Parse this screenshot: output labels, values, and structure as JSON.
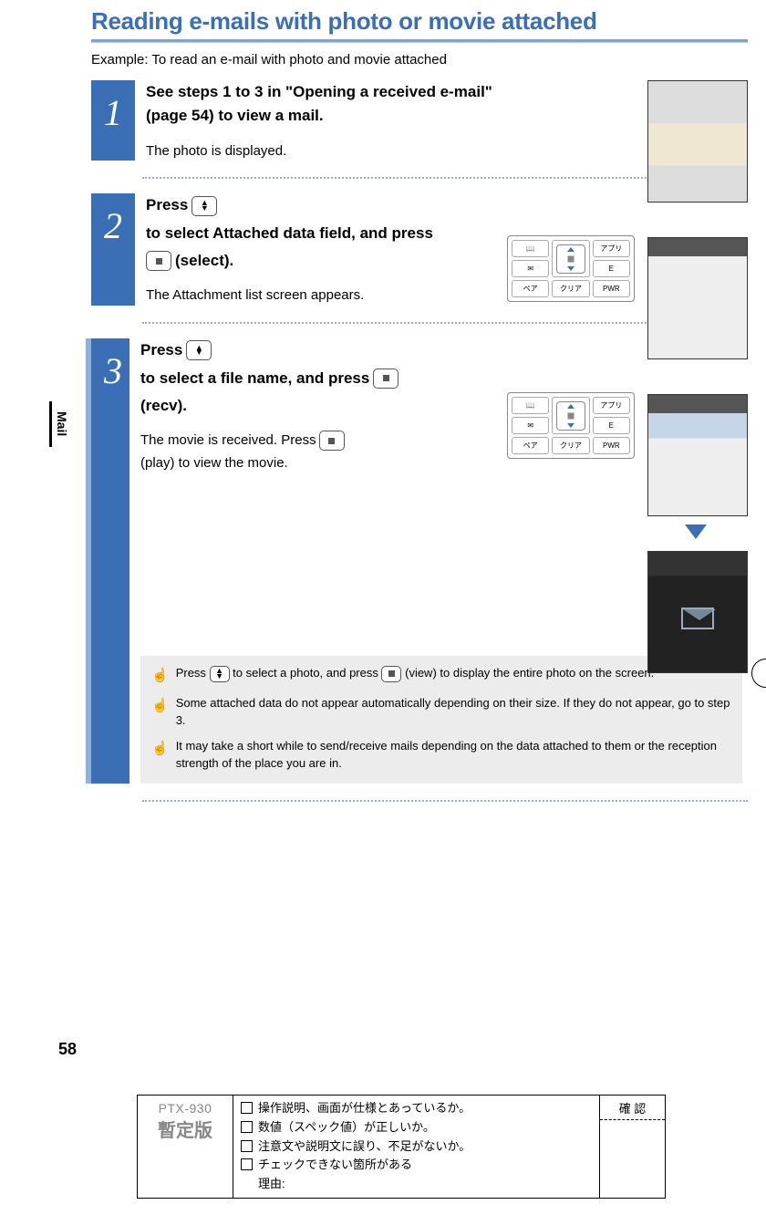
{
  "title": "Reading e-mails with photo or movie attached",
  "example": "Example: To read an e-mail with photo and movie attached",
  "side_tab": "Mail",
  "page_number": "58",
  "steps": [
    {
      "num": "1",
      "head": "See steps 1 to 3 in \"Opening a received e-mail\" (page 54) to view a mail.",
      "desc": "The photo is displayed."
    },
    {
      "num": "2",
      "head_pre": "Press ",
      "head_mid": " to select Attached data field, and press ",
      "head_post": " (select).",
      "desc": "The Attachment list screen appears."
    },
    {
      "num": "3",
      "head_pre": "Press ",
      "head_mid": " to select a file name, and press ",
      "head_post": " (recv).",
      "desc_pre": "The movie is received. Press ",
      "desc_post": " (play) to view the movie."
    }
  ],
  "tips": [
    {
      "pre": "Press ",
      "mid": " to select a photo, and press ",
      "post": " (view) to display the entire photo on the screen."
    },
    {
      "text": "Some attached data do not appear automatically depending on their size. If they do not appear, go to step 3."
    },
    {
      "text": "It may take a short while to send/receive mails depending on the data attached to them or the reception strength of the place you are in."
    }
  ],
  "keypad": {
    "top_left": "📖",
    "top_right": "アプリ",
    "mid_left": "✉",
    "mid_right": "E",
    "bot_left": "ペア",
    "bot_mid": "クリア",
    "bot_right": "PWR"
  },
  "footer": {
    "model": "PTX-930",
    "provisional": "暫定版",
    "check1": "操作説明、画面が仕様とあっているか。",
    "check2": "数値（スペック値）が正しいか。",
    "check3": "注意文や説明文に誤り、不足がないか。",
    "check4": "チェックできない箇所がある",
    "check4_reason": "理由:",
    "confirm": "確 認"
  }
}
